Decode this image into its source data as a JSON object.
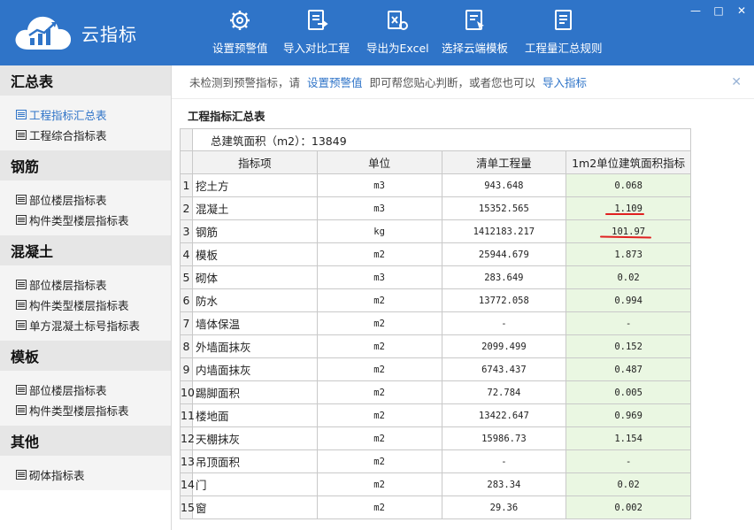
{
  "header": {
    "app_name": "云指标",
    "tools": [
      {
        "label": "设置预警值",
        "icon": "gear-icon"
      },
      {
        "label": "导入对比工程",
        "icon": "import-icon"
      },
      {
        "label": "导出为Excel",
        "icon": "excel-icon"
      },
      {
        "label": "选择云端模板",
        "icon": "template-icon"
      },
      {
        "label": "工程量汇总规则",
        "icon": "rules-icon"
      }
    ],
    "window": {
      "minimize": "—",
      "maximize": "□",
      "close": "✕"
    }
  },
  "sidebar": {
    "sections": [
      {
        "title": "汇总表",
        "items": [
          "工程指标汇总表",
          "工程综合指标表"
        ],
        "active_index": 0
      },
      {
        "title": "钢筋",
        "items": [
          "部位楼层指标表",
          "构件类型楼层指标表"
        ]
      },
      {
        "title": "混凝土",
        "items": [
          "部位楼层指标表",
          "构件类型楼层指标表",
          "单方混凝土标号指标表"
        ]
      },
      {
        "title": "模板",
        "items": [
          "部位楼层指标表",
          "构件类型楼层指标表"
        ]
      },
      {
        "title": "其他",
        "items": [
          "砌体指标表"
        ]
      }
    ]
  },
  "notice": {
    "prefix": "未检测到预警指标，请",
    "link1": "设置预警值",
    "middle": "即可帮您贴心判断，或者您也可以",
    "link2": "导入指标",
    "close": "✕"
  },
  "table": {
    "title": "工程指标汇总表",
    "area_label": "总建筑面积（m2）：13849",
    "headers": [
      "指标项",
      "单位",
      "清单工程量",
      "1m2单位建筑面积指标"
    ],
    "rows": [
      {
        "n": "1",
        "name": "挖土方",
        "unit": "m3",
        "qty": "943.648",
        "ind": "0.068"
      },
      {
        "n": "2",
        "name": "混凝土",
        "unit": "m3",
        "qty": "15352.565",
        "ind": "1.109"
      },
      {
        "n": "3",
        "name": "钢筋",
        "unit": "kg",
        "qty": "1412183.217",
        "ind": "101.97"
      },
      {
        "n": "4",
        "name": "模板",
        "unit": "m2",
        "qty": "25944.679",
        "ind": "1.873"
      },
      {
        "n": "5",
        "name": "砌体",
        "unit": "m3",
        "qty": "283.649",
        "ind": "0.02"
      },
      {
        "n": "6",
        "name": "防水",
        "unit": "m2",
        "qty": "13772.058",
        "ind": "0.994"
      },
      {
        "n": "7",
        "name": "墙体保温",
        "unit": "m2",
        "qty": "-",
        "ind": "-"
      },
      {
        "n": "8",
        "name": "外墙面抹灰",
        "unit": "m2",
        "qty": "2099.499",
        "ind": "0.152"
      },
      {
        "n": "9",
        "name": "内墙面抹灰",
        "unit": "m2",
        "qty": "6743.437",
        "ind": "0.487"
      },
      {
        "n": "10",
        "name": "踢脚面积",
        "unit": "m2",
        "qty": "72.784",
        "ind": "0.005"
      },
      {
        "n": "11",
        "name": "楼地面",
        "unit": "m2",
        "qty": "13422.647",
        "ind": "0.969"
      },
      {
        "n": "12",
        "name": "天棚抹灰",
        "unit": "m2",
        "qty": "15986.73",
        "ind": "1.154"
      },
      {
        "n": "13",
        "name": "吊顶面积",
        "unit": "m2",
        "qty": "-",
        "ind": "-"
      },
      {
        "n": "14",
        "name": "门",
        "unit": "m2",
        "qty": "283.34",
        "ind": "0.02"
      },
      {
        "n": "15",
        "name": "窗",
        "unit": "m2",
        "qty": "29.36",
        "ind": "0.002"
      }
    ]
  },
  "colors": {
    "header": "#2f74c8",
    "link": "#2f74c8",
    "indicator_bg": "#eaf7e2",
    "underline": "#e02020"
  }
}
